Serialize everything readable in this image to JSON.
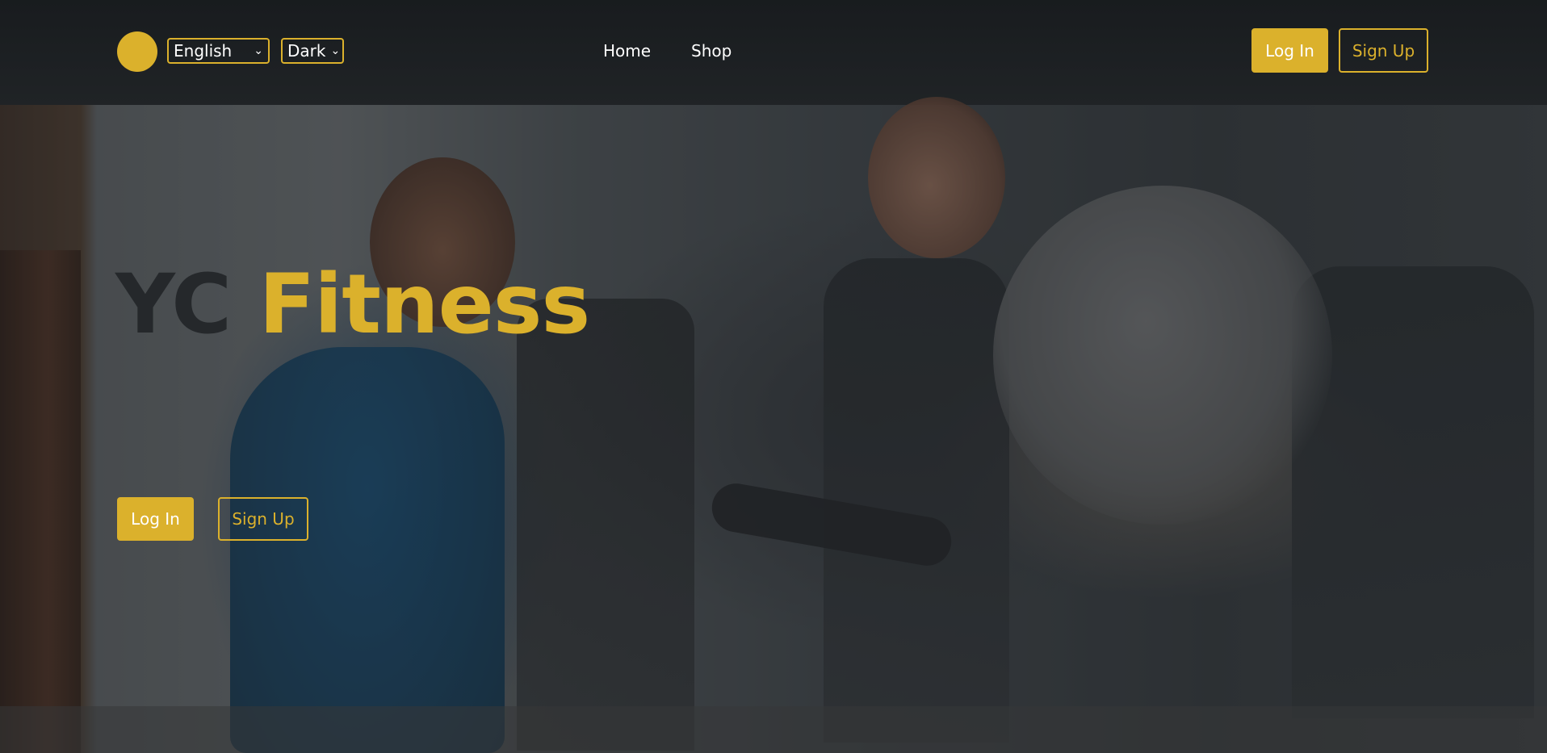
{
  "brand": {
    "accent_color": "#dbb12c"
  },
  "header": {
    "language_select": {
      "value": "English",
      "icon": "chevron-down-icon"
    },
    "theme_select": {
      "value": "Dark",
      "icon": "chevron-down-icon"
    },
    "nav": [
      {
        "label": "Home"
      },
      {
        "label": "Shop"
      }
    ],
    "login_label": "Log In",
    "signup_label": "Sign Up"
  },
  "hero": {
    "title_part1": "YC",
    "title_part2": "Fitness",
    "title_color_1": "#25282b",
    "title_color_2": "#dbb12c",
    "login_label": "Log In",
    "signup_label": "Sign Up"
  }
}
